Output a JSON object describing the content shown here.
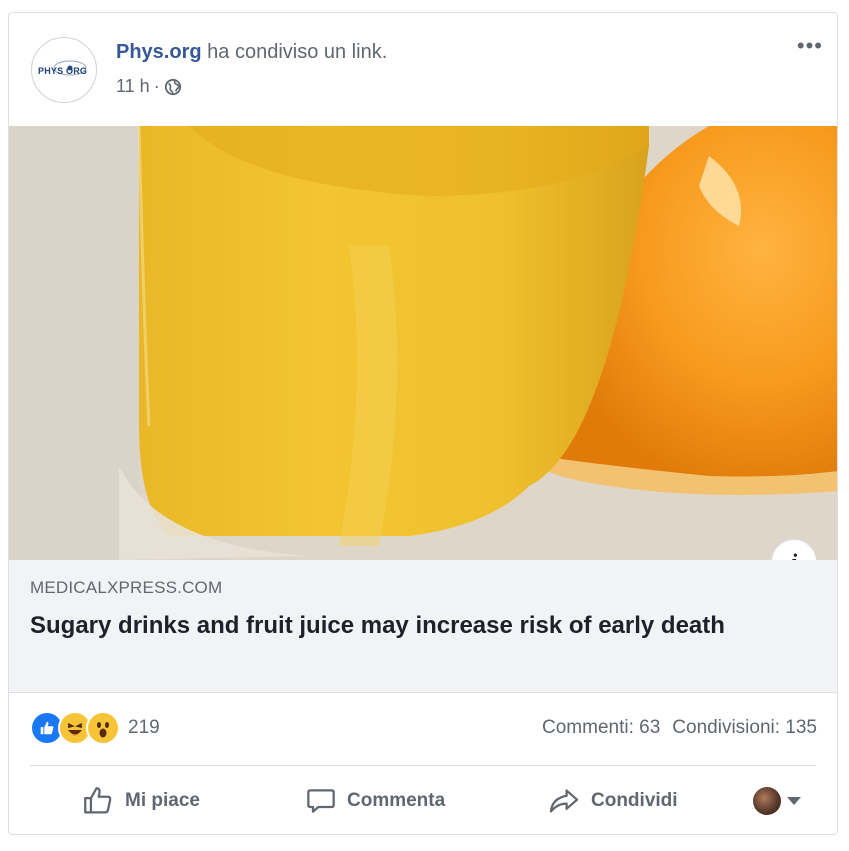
{
  "post": {
    "page_name": "Phys.org",
    "action_text": "ha condiviso un link.",
    "timestamp": "11 h",
    "separator": "·",
    "privacy_icon": "globe-icon",
    "more_label": "•••",
    "avatar_logo_text": "PHYS ORG"
  },
  "link_preview": {
    "domain": "MEDICALXPRESS.COM",
    "title": "Sugary drinks and fruit juice may increase risk of early death",
    "info_label": "i"
  },
  "reactions": {
    "icons": [
      "like-reaction-icon",
      "haha-reaction-icon",
      "wow-reaction-icon"
    ],
    "count": "219",
    "comments": "Commenti: 63",
    "shares": "Condivisioni: 135"
  },
  "actions": {
    "like": "Mi piace",
    "comment": "Commenta",
    "share": "Condividi"
  },
  "colors": {
    "page_link": "#365899",
    "like_blue": "#1a78f4",
    "emoji_yellow": "#f7c437",
    "secondary_text": "#606770",
    "preview_bg": "#f2f3f5"
  }
}
